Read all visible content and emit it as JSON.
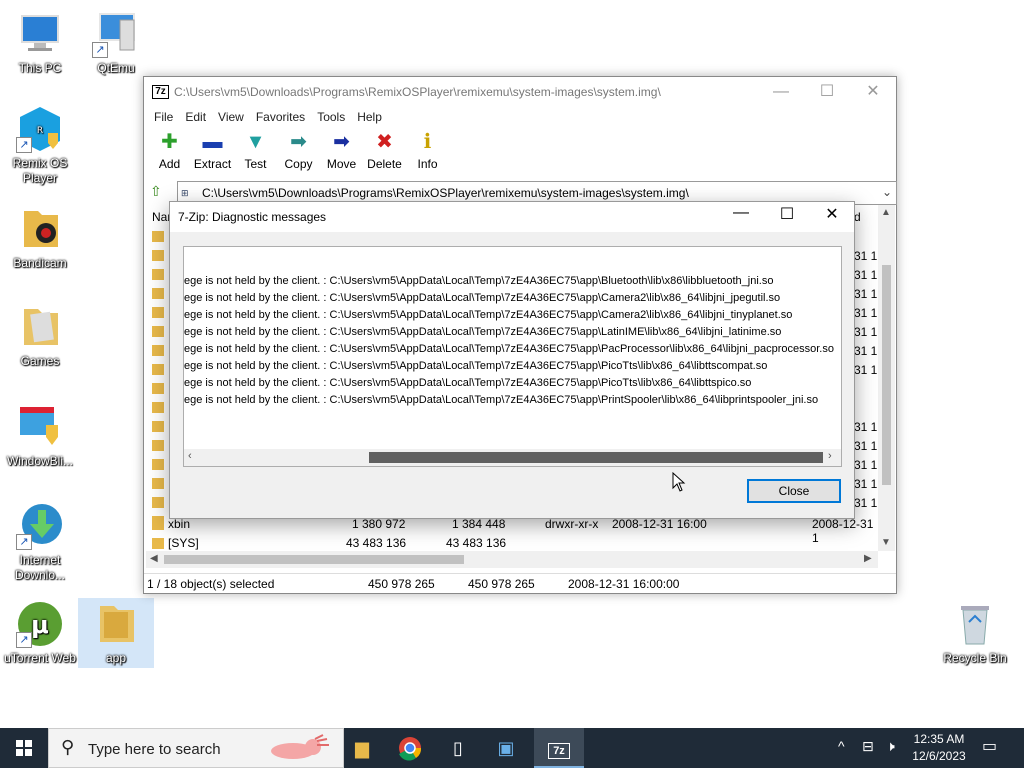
{
  "desktop": {
    "icons": [
      {
        "label": "This PC"
      },
      {
        "label": "QtEmu"
      },
      {
        "label": "Remix OS Player"
      },
      {
        "label": "Bandicam"
      },
      {
        "label": "Games"
      },
      {
        "label": "WindowBli..."
      },
      {
        "label": "Internet Downlo..."
      },
      {
        "label": "uTorrent Web"
      },
      {
        "label": "app"
      },
      {
        "label": "Recycle Bin"
      }
    ]
  },
  "zip_window": {
    "title": "C:\\Users\\vm5\\Downloads\\Programs\\RemixOSPlayer\\remixemu\\system-images\\system.img\\",
    "app_badge": "7z",
    "menu": [
      "File",
      "Edit",
      "View",
      "Favorites",
      "Tools",
      "Help"
    ],
    "toolbar": [
      "Add",
      "Extract",
      "Test",
      "Copy",
      "Move",
      "Delete",
      "Info"
    ],
    "address": "C:\\Users\\vm5\\Downloads\\Programs\\RemixOSPlayer\\remixemu\\system-images\\system.img\\",
    "header_name_partial": "Nar",
    "header_right_partial": "d",
    "date_partial": "-31 1",
    "rows": [
      {
        "name": "xbin",
        "size": "1 380 972",
        "packed": "1 384 448",
        "attr": "drwxr-xr-x",
        "modified": "2008-12-31 16:00",
        "created": "2008-12-31 1"
      },
      {
        "name": "[SYS]",
        "size": "43 483 136",
        "packed": "43 483 136",
        "attr": "",
        "modified": "",
        "created": ""
      }
    ],
    "status": {
      "selected": "1 / 18 object(s) selected",
      "size": "450 978 265",
      "packed": "450 978 265",
      "date": "2008-12-31 16:00:00"
    }
  },
  "dialog": {
    "title": "7-Zip: Diagnostic messages",
    "messages": [
      "ege is not held by the client. : C:\\Users\\vm5\\AppData\\Local\\Temp\\7zE4A36EC75\\app\\Bluetooth\\lib\\x86\\libbluetooth_jni.so",
      "ege is not held by the client. : C:\\Users\\vm5\\AppData\\Local\\Temp\\7zE4A36EC75\\app\\Camera2\\lib\\x86_64\\libjni_jpegutil.so",
      "ege is not held by the client. : C:\\Users\\vm5\\AppData\\Local\\Temp\\7zE4A36EC75\\app\\Camera2\\lib\\x86_64\\libjni_tinyplanet.so",
      "ege is not held by the client. : C:\\Users\\vm5\\AppData\\Local\\Temp\\7zE4A36EC75\\app\\LatinIME\\lib\\x86_64\\libjni_latinime.so",
      "ege is not held by the client. : C:\\Users\\vm5\\AppData\\Local\\Temp\\7zE4A36EC75\\app\\PacProcessor\\lib\\x86_64\\libjni_pacprocessor.so",
      "ege is not held by the client. : C:\\Users\\vm5\\AppData\\Local\\Temp\\7zE4A36EC75\\app\\PicoTts\\lib\\x86_64\\libttscompat.so",
      "ege is not held by the client. : C:\\Users\\vm5\\AppData\\Local\\Temp\\7zE4A36EC75\\app\\PicoTts\\lib\\x86_64\\libttspico.so",
      "ege is not held by the client. : C:\\Users\\vm5\\AppData\\Local\\Temp\\7zE4A36EC75\\app\\PrintSpooler\\lib\\x86_64\\libprintspooler_jni.so"
    ],
    "close_label": "Close"
  },
  "taskbar": {
    "search_placeholder": "Type here to search",
    "time": "12:35 AM",
    "date": "12/6/2023",
    "zip_badge": "7z"
  },
  "colors": {
    "taskbar_bg": "#1f2b38",
    "accent": "#0078d7"
  }
}
